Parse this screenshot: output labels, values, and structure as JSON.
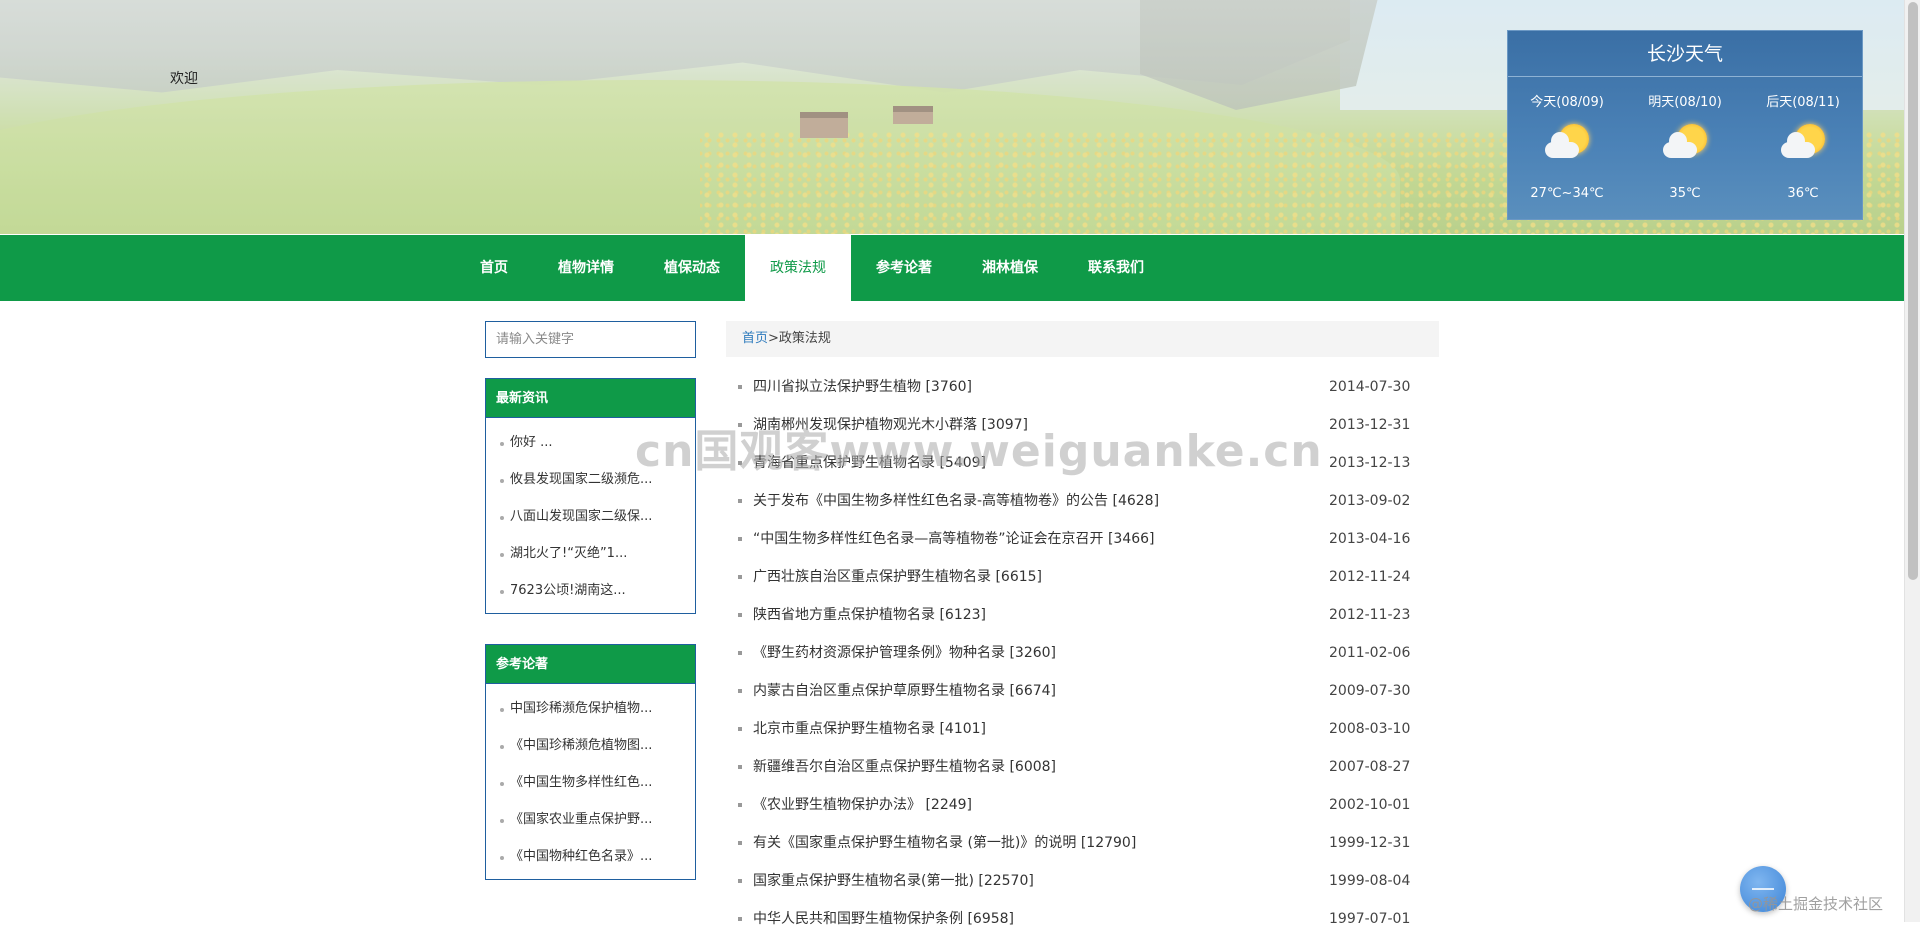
{
  "header": {
    "welcome": "欢迎"
  },
  "weather": {
    "title": "长沙天气",
    "days": [
      {
        "label": "今天(08/09)",
        "icon": "partly-cloudy-icon",
        "temp": "27℃~34℃"
      },
      {
        "label": "明天(08/10)",
        "icon": "partly-cloudy-icon",
        "temp": "35℃"
      },
      {
        "label": "后天(08/11)",
        "icon": "partly-cloudy-icon",
        "temp": "36℃"
      }
    ]
  },
  "nav": {
    "items": [
      "首页",
      "植物详情",
      "植保动态",
      "政策法规",
      "参考论著",
      "湘林植保",
      "联系我们"
    ],
    "active_index": 3
  },
  "search": {
    "placeholder": "请输入关键字"
  },
  "sidebar": {
    "latest": {
      "title": "最新资讯",
      "items": [
        "你好 ...",
        "攸县发现国家二级濒危...",
        "八面山发现国家二级保...",
        "湖北火了!“灭绝”1...",
        "7623公顷!湖南这..."
      ]
    },
    "references": {
      "title": "参考论著",
      "items": [
        "中国珍稀濒危保护植物...",
        "《中国珍稀濒危植物图...",
        "《中国生物多样性红色...",
        "《国家农业重点保护野...",
        "《中国物种红色名录》..."
      ]
    }
  },
  "breadcrumb": {
    "home": "首页",
    "separator": ">",
    "current": "政策法规"
  },
  "news": [
    {
      "title": "四川省拟立法保护野生植物 [3760]",
      "date": "2014-07-30"
    },
    {
      "title": "湖南郴州发现保护植物观光木小群落 [3097]",
      "date": "2013-12-31"
    },
    {
      "title": "青海省重点保护野生植物名录 [5409]",
      "date": "2013-12-13"
    },
    {
      "title": "关于发布《中国生物多样性红色名录-高等植物卷》的公告 [4628]",
      "date": "2013-09-02"
    },
    {
      "title": "“中国生物多样性红色名录—高等植物卷”论证会在京召开 [3466]",
      "date": "2013-04-16"
    },
    {
      "title": "广西壮族自治区重点保护野生植物名录 [6615]",
      "date": "2012-11-24"
    },
    {
      "title": "陕西省地方重点保护植物名录 [6123]",
      "date": "2012-11-23"
    },
    {
      "title": "《野生药材资源保护管理条例》物种名录 [3260]",
      "date": "2011-02-06"
    },
    {
      "title": "内蒙古自治区重点保护草原野生植物名录 [6674]",
      "date": "2009-07-30"
    },
    {
      "title": "北京市重点保护野生植物名录 [4101]",
      "date": "2008-03-10"
    },
    {
      "title": "新疆维吾尔自治区重点保护野生植物名录 [6008]",
      "date": "2007-08-27"
    },
    {
      "title": "《农业野生植物保护办法》 [2249]",
      "date": "2002-10-01"
    },
    {
      "title": "有关《国家重点保护野生植物名录 (第一批)》的说明 [12790]",
      "date": "1999-12-31"
    },
    {
      "title": "国家重点保护野生植物名录(第一批) [22570]",
      "date": "1999-08-04"
    },
    {
      "title": "中华人民共和国野生植物保护条例 [6958]",
      "date": "1997-07-01"
    }
  ],
  "overlays": {
    "watermark": "cn国观客www.weiguanke.cn",
    "corner": "@稀土掘金技术社区"
  },
  "colors": {
    "nav_green": "#0f9a48",
    "weather_blue": "#3a6fa5",
    "border_blue": "#1f5f9f",
    "link_blue": "#2e7bbd"
  }
}
